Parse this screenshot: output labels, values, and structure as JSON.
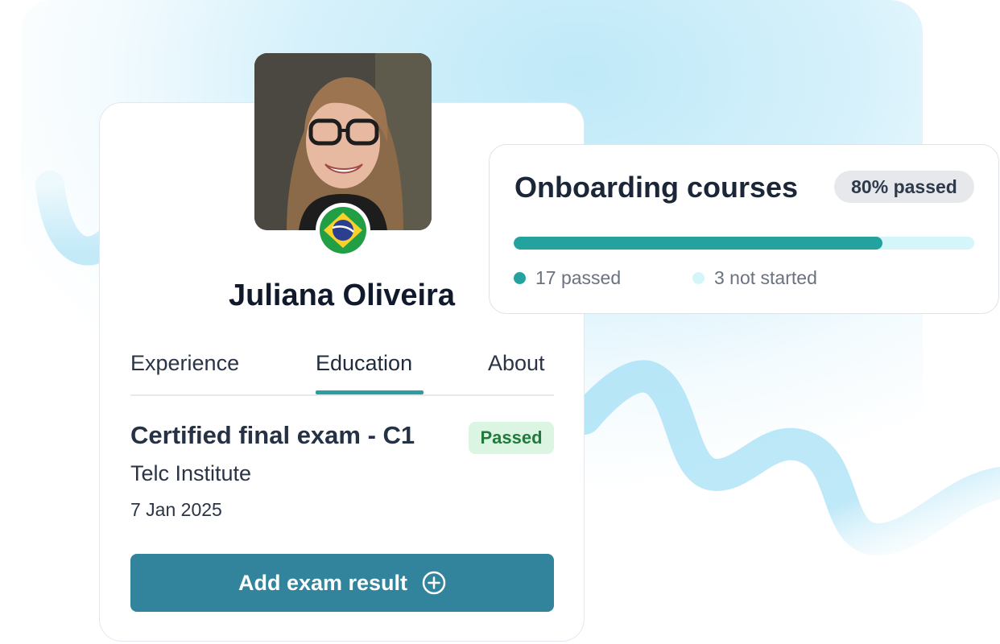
{
  "profile": {
    "name": "Juliana Oliveira",
    "country_flag": "brazil-flag-icon"
  },
  "tabs": [
    {
      "label": "Experience",
      "active": false
    },
    {
      "label": "Education",
      "active": true
    },
    {
      "label": "About",
      "active": false
    }
  ],
  "exam": {
    "title": "Certified final exam - C1",
    "status": "Passed",
    "institute": "Telc Institute",
    "date": "7 Jan 2025"
  },
  "add_button": {
    "label": "Add exam result",
    "icon": "plus-circle-icon"
  },
  "courses": {
    "title": "Onboarding courses",
    "badge": "80% passed",
    "progress_fraction": 0.8,
    "legend": [
      {
        "label": "17 passed",
        "color": "#23a29e"
      },
      {
        "label": "3 not started",
        "color": "#d4f6fb"
      }
    ]
  },
  "colors": {
    "accent": "#23a29e",
    "button": "#32849c",
    "passed_bg": "#dcf5e2",
    "passed_text": "#1f7a3b"
  }
}
